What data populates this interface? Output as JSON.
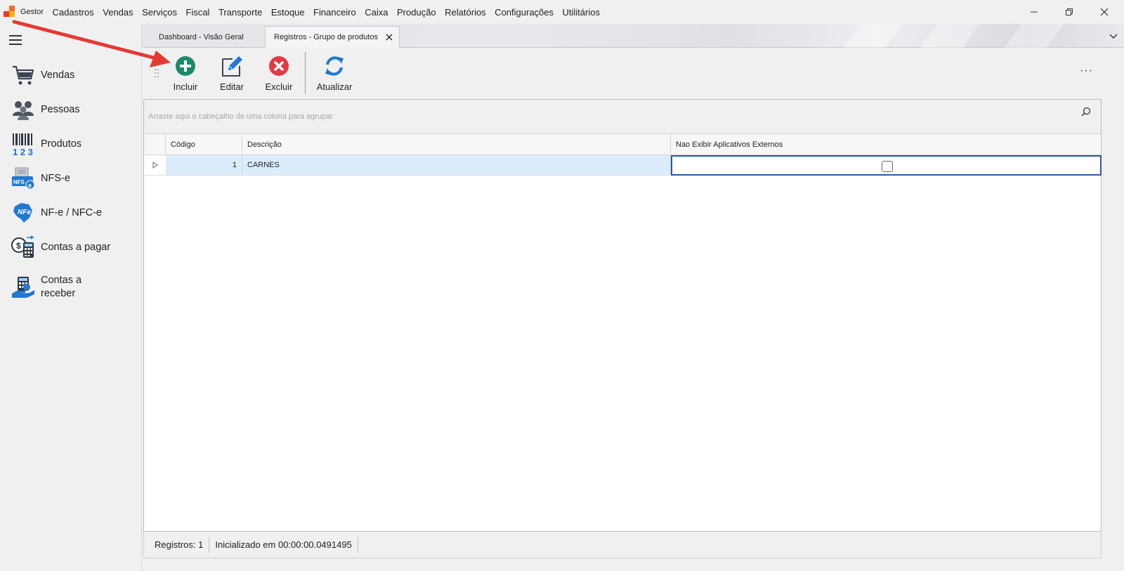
{
  "menubar": {
    "app_name": "Gestor",
    "items": [
      "Cadastros",
      "Vendas",
      "Serviços",
      "Fiscal",
      "Transporte",
      "Estoque",
      "Financeiro",
      "Caixa",
      "Produção",
      "Relatórios",
      "Configurações",
      "Utilitários"
    ],
    "logo_colors": [
      "#f36c21",
      "#e53935",
      "#ffb300"
    ]
  },
  "window_controls": [
    "minimize-icon",
    "restore-icon",
    "close-icon"
  ],
  "sidebar": {
    "items": [
      {
        "label": "Vendas",
        "icon": "shopping-cart-icon"
      },
      {
        "label": "Pessoas",
        "icon": "people-icon"
      },
      {
        "label": "Produtos",
        "icon": "barcode-icon"
      },
      {
        "label": "NFS-e",
        "icon": "nfse-icon"
      },
      {
        "label": "NF-e / NFC-e",
        "icon": "nfe-icon"
      },
      {
        "label": "Contas a pagar",
        "icon": "calculator-money-icon"
      },
      {
        "label": "Contas a receber",
        "icon": "hand-money-icon"
      }
    ]
  },
  "tabs": [
    {
      "label": "Dashboard - Visão Geral",
      "active": false
    },
    {
      "label": "Registros - Grupo de produtos",
      "active": true
    }
  ],
  "toolbar": {
    "incluir": "Incluir",
    "editar": "Editar",
    "excluir": "Excluir",
    "atualizar": "Atualizar",
    "more": "···"
  },
  "grid": {
    "group_hint": "Arraste aqui o cabeçalho de uma coluna para agrupar",
    "columns": [
      "Código",
      "Descrição",
      "Nao Exibir Aplicativos Externos"
    ],
    "rows": [
      {
        "codigo": "1",
        "descricao": "CARNES",
        "nao_exibir": false
      }
    ]
  },
  "status": {
    "registros": "Registros: 1",
    "inicializado": "Inicializado em 00:00:00.0491495"
  },
  "colors": {
    "accent_add": "#1a8a6a",
    "accent_delete": "#e53946",
    "accent_refresh": "#1f78d1",
    "selection": "#dcecfc",
    "arrow": "#e53935"
  }
}
